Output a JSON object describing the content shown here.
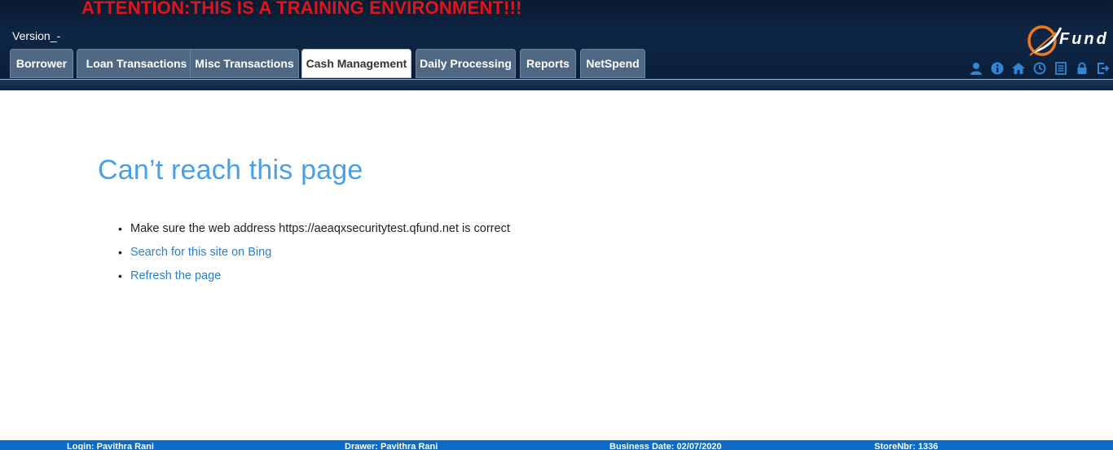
{
  "banner": "ATTENTION:THIS IS A TRAINING ENVIRONMENT!!!",
  "version": "Version_-",
  "tabs": [
    {
      "label": "Borrower",
      "active": false
    },
    {
      "label": "Loan Transactions",
      "active": false
    },
    {
      "label": "Misc Transactions",
      "active": false
    },
    {
      "label": "Cash Management",
      "active": true
    },
    {
      "label": "Daily Processing",
      "active": false
    },
    {
      "label": "Reports",
      "active": false
    },
    {
      "label": "NetSpend",
      "active": false
    }
  ],
  "logo": {
    "text": "Fund"
  },
  "toolbar_icons": [
    "user-icon",
    "info-icon",
    "home-icon",
    "clock-icon",
    "notepad-icon",
    "lock-icon",
    "logout-icon"
  ],
  "error_page": {
    "title": "Can’t reach this page",
    "items": [
      "Make sure the web address https://aeaqxsecuritytest.qfund.net is correct",
      "Search for this site on Bing",
      "Refresh the page"
    ]
  },
  "footer": {
    "login": "Login: Pavithra Rani",
    "drawer": "Drawer: Pavithra Rani",
    "business_date": "Business Date: 02/07/2020",
    "store": "StoreNbr: 1336"
  },
  "colors": {
    "banner_red": "#e0151b",
    "tab_bg": "#4f6985",
    "link_blue": "#2b7fcf",
    "title_blue": "#4aa0e6",
    "footer_blue": "#0a6bc8",
    "icon_blue": "#2f86d6",
    "logo_orange": "#f07a1a"
  }
}
